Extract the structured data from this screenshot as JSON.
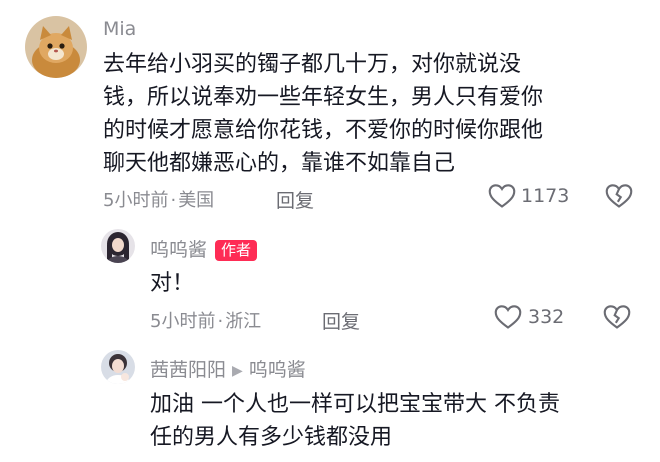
{
  "comments": [
    {
      "user": "Mia",
      "text_lines": [
        "去年给小羽买的镯子都几十万，对你就说没",
        "钱，所以说奉劝一些年轻女生，男人只有爱你",
        "的时候才愿意给你花钱，不爱你的时候你跟他",
        "聊天他都嫌恶心的，靠谁不如靠自己"
      ],
      "time": "5小时前",
      "location": "美国",
      "reply_label": "回复",
      "likes": "1173"
    },
    {
      "user": "呜呜酱",
      "tag": "作者",
      "text": "对！",
      "time": "5小时前",
      "location": "浙江",
      "reply_label": "回复",
      "likes": "332"
    },
    {
      "user": "茜茜阳阳",
      "reply_to": "呜呜酱",
      "text_lines": [
        "加油 一个人也一样可以把宝宝带大 不负责",
        "任的男人有多少钱都没用"
      ]
    }
  ],
  "meta_separator": "·",
  "colors": {
    "author_tag": "#fe2c55",
    "text": "#161823",
    "secondary": "#8a8b91"
  }
}
